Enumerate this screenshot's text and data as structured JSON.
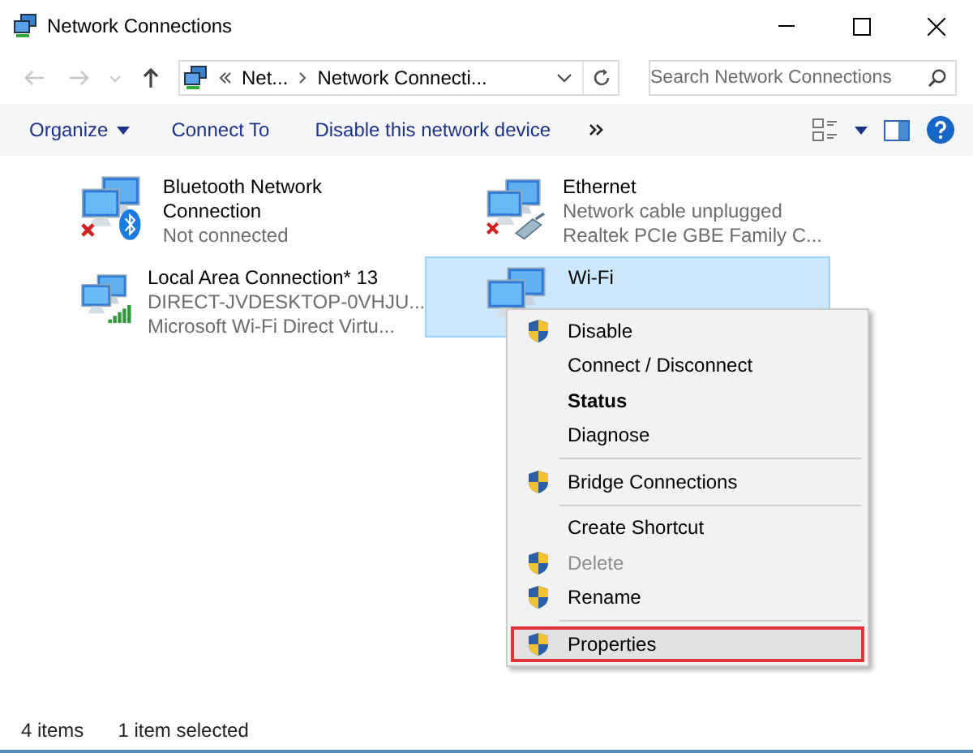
{
  "window": {
    "title": "Network Connections"
  },
  "nav_buttons": [
    {
      "kind": "back",
      "disabled": true
    },
    {
      "kind": "forward",
      "disabled": true
    },
    {
      "kind": "recent",
      "disabled": true
    },
    {
      "kind": "up",
      "disabled": false
    }
  ],
  "address_bar": {
    "path": [
      "Net...",
      "Network Connecti..."
    ]
  },
  "search": {
    "placeholder": "Search Network Connections"
  },
  "toolbar": [
    {
      "label": "Organize",
      "dropdown": true
    },
    {
      "label": "Connect To",
      "dropdown": false
    },
    {
      "label": "Disable this network device",
      "dropdown": false
    }
  ],
  "connections": [
    {
      "name": "Bluetooth Network Connection",
      "lines": [
        "Not connected"
      ],
      "kind": "bluetooth",
      "disconnected": true,
      "selected": false
    },
    {
      "name": "Ethernet",
      "lines": [
        "Network cable unplugged",
        "Realtek PCIe GBE Family C..."
      ],
      "kind": "cable",
      "disconnected": true,
      "selected": false
    },
    {
      "name": "Local Area Connection* 13",
      "lines": [
        "DIRECT-JVDESKTOP-0VHJU...",
        "Microsoft Wi-Fi Direct Virtu..."
      ],
      "kind": "signal",
      "disconnected": false,
      "selected": false
    },
    {
      "name": "Wi-Fi",
      "kind": "plain",
      "disconnected": false,
      "selected": true
    }
  ],
  "context_menu": [
    {
      "kind": "item",
      "label": "Disable",
      "shield": true,
      "bold": false,
      "disabled": false,
      "highlighted": false
    },
    {
      "kind": "item",
      "label": "Connect / Disconnect",
      "shield": false,
      "bold": false,
      "disabled": false,
      "highlighted": false
    },
    {
      "kind": "item",
      "label": "Status",
      "shield": false,
      "bold": true,
      "disabled": false,
      "highlighted": false
    },
    {
      "kind": "item",
      "label": "Diagnose",
      "shield": false,
      "bold": false,
      "disabled": false,
      "highlighted": false
    },
    {
      "kind": "separator"
    },
    {
      "kind": "item",
      "label": "Bridge Connections",
      "shield": true,
      "bold": false,
      "disabled": false,
      "highlighted": false
    },
    {
      "kind": "separator"
    },
    {
      "kind": "item",
      "label": "Create Shortcut",
      "shield": false,
      "bold": false,
      "disabled": false,
      "highlighted": false
    },
    {
      "kind": "item",
      "label": "Delete",
      "shield": true,
      "bold": false,
      "disabled": true,
      "highlighted": false
    },
    {
      "kind": "item",
      "label": "Rename",
      "shield": true,
      "bold": false,
      "disabled": false,
      "highlighted": false
    },
    {
      "kind": "separator"
    },
    {
      "kind": "item",
      "label": "Properties",
      "shield": true,
      "bold": false,
      "disabled": false,
      "highlighted": true
    }
  ],
  "status_bar": {
    "count": "4 items",
    "selection": "1 item selected"
  }
}
